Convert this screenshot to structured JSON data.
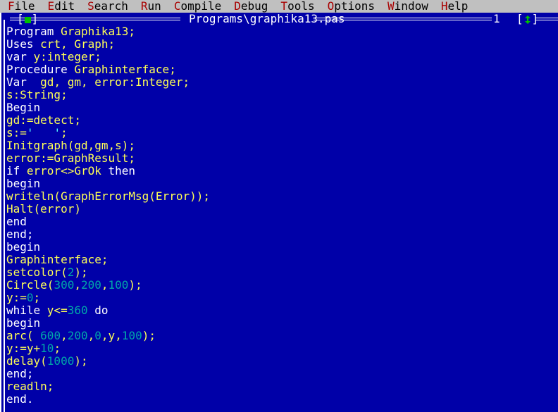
{
  "menubar": {
    "items": [
      {
        "name": "file",
        "hotkey": "F",
        "rest": "ile"
      },
      {
        "name": "edit",
        "hotkey": "E",
        "rest": "dit"
      },
      {
        "name": "search",
        "hotkey": "S",
        "rest": "earch"
      },
      {
        "name": "run",
        "hotkey": "R",
        "rest": "un"
      },
      {
        "name": "compile",
        "hotkey": "C",
        "rest": "ompile"
      },
      {
        "name": "debug",
        "hotkey": "D",
        "rest": "ebug"
      },
      {
        "name": "tools",
        "hotkey": "T",
        "rest": "ools"
      },
      {
        "name": "options",
        "hotkey": "O",
        "rest": "ptions"
      },
      {
        "name": "window",
        "hotkey": "W",
        "rest": "indow"
      },
      {
        "name": "help",
        "hotkey": "H",
        "rest": "elp"
      }
    ]
  },
  "window": {
    "title": "Programs\\graphika13.pas",
    "number": "1",
    "close_box": "[■]",
    "zoom_box": "[↕]",
    "close_icon": "close-box-icon",
    "zoom_icon": "zoom-resize-icon"
  },
  "colors": {
    "menubar_bg": "#c0c0c0",
    "menubar_fg": "#000000",
    "hotkey": "#a80000",
    "window_bg": "#0000a8",
    "frame": "#ffffff",
    "keyword": "#ffffff",
    "identifier": "#ffff55",
    "number": "#00a8a8",
    "string": "#55ffff",
    "accent_green": "#00c000"
  },
  "editor": {
    "lines": [
      [
        {
          "t": "Program ",
          "c": "kw"
        },
        {
          "t": "Graphika13",
          "c": "id"
        },
        {
          "t": ";",
          "c": "id"
        }
      ],
      [
        {
          "t": "Uses ",
          "c": "kw"
        },
        {
          "t": "crt",
          "c": "id"
        },
        {
          "t": ", ",
          "c": "id"
        },
        {
          "t": "Graph",
          "c": "id"
        },
        {
          "t": ";",
          "c": "id"
        }
      ],
      [
        {
          "t": "var ",
          "c": "kw"
        },
        {
          "t": "y",
          "c": "id"
        },
        {
          "t": ":",
          "c": "id"
        },
        {
          "t": "integer",
          "c": "id"
        },
        {
          "t": ";",
          "c": "id"
        }
      ],
      [
        {
          "t": "Procedure ",
          "c": "kw"
        },
        {
          "t": "Graphinterface",
          "c": "id"
        },
        {
          "t": ";",
          "c": "id"
        }
      ],
      [
        {
          "t": "Var  ",
          "c": "kw"
        },
        {
          "t": "gd, gm, error:Integer;",
          "c": "id"
        }
      ],
      [
        {
          "t": "s:String;",
          "c": "id"
        }
      ],
      [
        {
          "t": "Begin",
          "c": "kw"
        }
      ],
      [
        {
          "t": "gd:=detect;",
          "c": "id"
        }
      ],
      [
        {
          "t": "s:=",
          "c": "id"
        },
        {
          "t": "'   '",
          "c": "str"
        },
        {
          "t": ";",
          "c": "id"
        }
      ],
      [
        {
          "t": "Initgraph(gd,gm,s);",
          "c": "id"
        }
      ],
      [
        {
          "t": "error:=GraphResult;",
          "c": "id"
        }
      ],
      [
        {
          "t": "if ",
          "c": "kw"
        },
        {
          "t": "error<>GrOk",
          "c": "id"
        },
        {
          "t": " then",
          "c": "kw"
        }
      ],
      [
        {
          "t": "begin",
          "c": "kw"
        }
      ],
      [
        {
          "t": "writeln(GraphErrorMsg(Error));",
          "c": "id"
        }
      ],
      [
        {
          "t": "Halt(error)",
          "c": "id"
        }
      ],
      [
        {
          "t": "end",
          "c": "kw"
        }
      ],
      [
        {
          "t": "end;",
          "c": "kw"
        }
      ],
      [
        {
          "t": "begin",
          "c": "kw"
        }
      ],
      [
        {
          "t": "Graphinterface;",
          "c": "id"
        }
      ],
      [
        {
          "t": "setcolor(",
          "c": "id"
        },
        {
          "t": "2",
          "c": "num"
        },
        {
          "t": ");",
          "c": "id"
        }
      ],
      [
        {
          "t": "Circle(",
          "c": "id"
        },
        {
          "t": "300",
          "c": "num"
        },
        {
          "t": ",",
          "c": "id"
        },
        {
          "t": "200",
          "c": "num"
        },
        {
          "t": ",",
          "c": "id"
        },
        {
          "t": "100",
          "c": "num"
        },
        {
          "t": ");",
          "c": "id"
        }
      ],
      [
        {
          "t": "y:=",
          "c": "id"
        },
        {
          "t": "0",
          "c": "num"
        },
        {
          "t": ";",
          "c": "id"
        }
      ],
      [
        {
          "t": "while ",
          "c": "kw"
        },
        {
          "t": "y<=",
          "c": "id"
        },
        {
          "t": "360",
          "c": "num"
        },
        {
          "t": " do",
          "c": "kw"
        }
      ],
      [
        {
          "t": "begin",
          "c": "kw"
        }
      ],
      [
        {
          "t": "arc( ",
          "c": "id"
        },
        {
          "t": "600",
          "c": "num"
        },
        {
          "t": ",",
          "c": "id"
        },
        {
          "t": "200",
          "c": "num"
        },
        {
          "t": ",",
          "c": "id"
        },
        {
          "t": "0",
          "c": "num"
        },
        {
          "t": ",",
          "c": "id"
        },
        {
          "t": "y",
          "c": "id"
        },
        {
          "t": ",",
          "c": "id"
        },
        {
          "t": "100",
          "c": "num"
        },
        {
          "t": ");",
          "c": "id"
        }
      ],
      [
        {
          "t": "y:=y+",
          "c": "id"
        },
        {
          "t": "10",
          "c": "num"
        },
        {
          "t": ";",
          "c": "id"
        }
      ],
      [
        {
          "t": "delay(",
          "c": "id"
        },
        {
          "t": "1000",
          "c": "num"
        },
        {
          "t": ");",
          "c": "id"
        }
      ],
      [
        {
          "t": "end;",
          "c": "kw"
        }
      ],
      [
        {
          "t": "readln;",
          "c": "id"
        }
      ],
      [
        {
          "t": "end.",
          "c": "kw"
        }
      ]
    ]
  }
}
